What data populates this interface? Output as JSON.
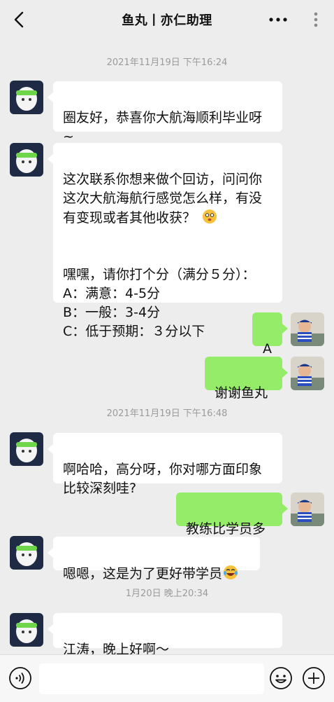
{
  "header": {
    "title": "鱼丸丨亦仁助理"
  },
  "timestamps": [
    "2021年11月19日 下午16:24",
    "2021年11月19日 下午16:48",
    "1月20日 晚上20:34"
  ],
  "messages": [
    {
      "text": "圈友好，恭喜你大航海顺利毕业呀~"
    },
    {
      "text": "这次联系你想来做个回访，问问你\n这次大航海航行感觉怎么样，有没\n有变现或者其他收获？"
    },
    {
      "text": "嘿嘿，请你打个分（满分５分）：\nA：满意：4-5分\nB：一般：3-4分\nC：低于预期：３分以下"
    },
    {
      "text": "A"
    },
    {
      "text": "谢谢鱼丸"
    },
    {
      "text": "啊哈哈，高分呀，你对哪方面印象\n比较深刻哇?"
    },
    {
      "text": "教练比学员多"
    },
    {
      "text": "嗯嗯，这是为了更好带学员"
    },
    {
      "text": "江涛，晚上好啊～"
    }
  ],
  "input": {
    "placeholder": ""
  },
  "colors": {
    "background": "#ededed",
    "incoming_bubble": "#ffffff",
    "outgoing_bubble": "#95ec69",
    "timestamp_text": "#9b9b9b"
  },
  "icons": [
    "back-arrow-icon",
    "more-dots-icon",
    "voice-icon",
    "emoji-icon",
    "plus-icon"
  ]
}
